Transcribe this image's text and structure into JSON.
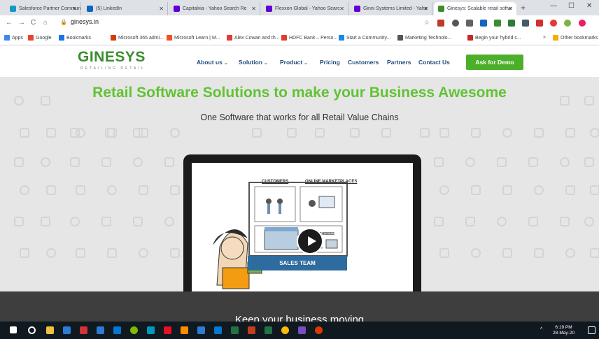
{
  "browser": {
    "tabs": [
      {
        "title": "Salesforce Partner Communi",
        "favicon_color": "#1798c1",
        "left": 0
      },
      {
        "title": "(5) LinkedIn",
        "favicon_color": "#0a66c2"
      },
      {
        "title": "Capitalvia - Yahoo Search Re",
        "favicon_color": "#6001d2"
      },
      {
        "title": "Flexxon Global - Yahoo Searc",
        "favicon_color": "#6001d2"
      },
      {
        "title": "Ginni Systems Limited - Yaho",
        "favicon_color": "#6001d2"
      },
      {
        "title": "Ginesys: Scalable retail softw",
        "favicon_color": "#3c8d2f",
        "active": true
      }
    ],
    "new_tab": "+",
    "window_controls": {
      "minimize": "—",
      "maximize": "☐",
      "close": "✕"
    },
    "nav": {
      "back": "←",
      "forward": "→",
      "reload": "C",
      "home": "⌂"
    },
    "url": "ginesys.in",
    "bookmarks": [
      {
        "label": "Apps",
        "color": "#4285f4"
      },
      {
        "label": "Google",
        "color": "#ea4335"
      },
      {
        "label": "Bookmarks",
        "color": "#1a73e8"
      },
      {
        "label": "Microsoft 365 admi...",
        "color": "#d83b01"
      },
      {
        "label": "Microsoft Learn | M...",
        "color": "#f25022"
      },
      {
        "label": "Alex Cowan and th...",
        "color": "#e03c31"
      },
      {
        "label": "HDFC Bank – Perso...",
        "color": "#e03c31"
      },
      {
        "label": "Start a Community...",
        "color": "#1e88e5"
      },
      {
        "label": "Marketing Technolo...",
        "color": "#555555"
      },
      {
        "label": "Begin your hybrid c...",
        "color": "#c62828"
      }
    ],
    "bookmarks_more": "»",
    "other_bookmarks": "Other bookmarks"
  },
  "site": {
    "logo": "GINESYS",
    "tagline": "RETAILING RETAIL",
    "menu": [
      {
        "label": "About us",
        "dropdown": true
      },
      {
        "label": "Solution",
        "dropdown": true
      },
      {
        "label": "Product",
        "dropdown": true
      },
      {
        "label": "Pricing",
        "dropdown": false
      },
      {
        "label": "Customers",
        "dropdown": false
      },
      {
        "label": "Partners",
        "dropdown": false
      },
      {
        "label": "Contact Us",
        "dropdown": false
      }
    ],
    "cta": "Ask for Demo",
    "hero_title": "Retail Software Solutions to make your Business Awesome",
    "hero_subtitle": "One Software that works for all Retail Value Chains",
    "video": {
      "label_customers": "CUSTOMERS",
      "label_marketplaces": "ONLINE MARKETPLACES",
      "label_franchisees": "FRANCHISEES",
      "label_sales_team": "SALES TEAM"
    },
    "band_text": "Keep your business moving",
    "colors": {
      "brand_green": "#62c234",
      "cta_green": "#4caf2a",
      "nav_blue": "#1f4b7a"
    }
  },
  "taskbar": {
    "time": "6:19 PM",
    "date": "28-May-20"
  }
}
